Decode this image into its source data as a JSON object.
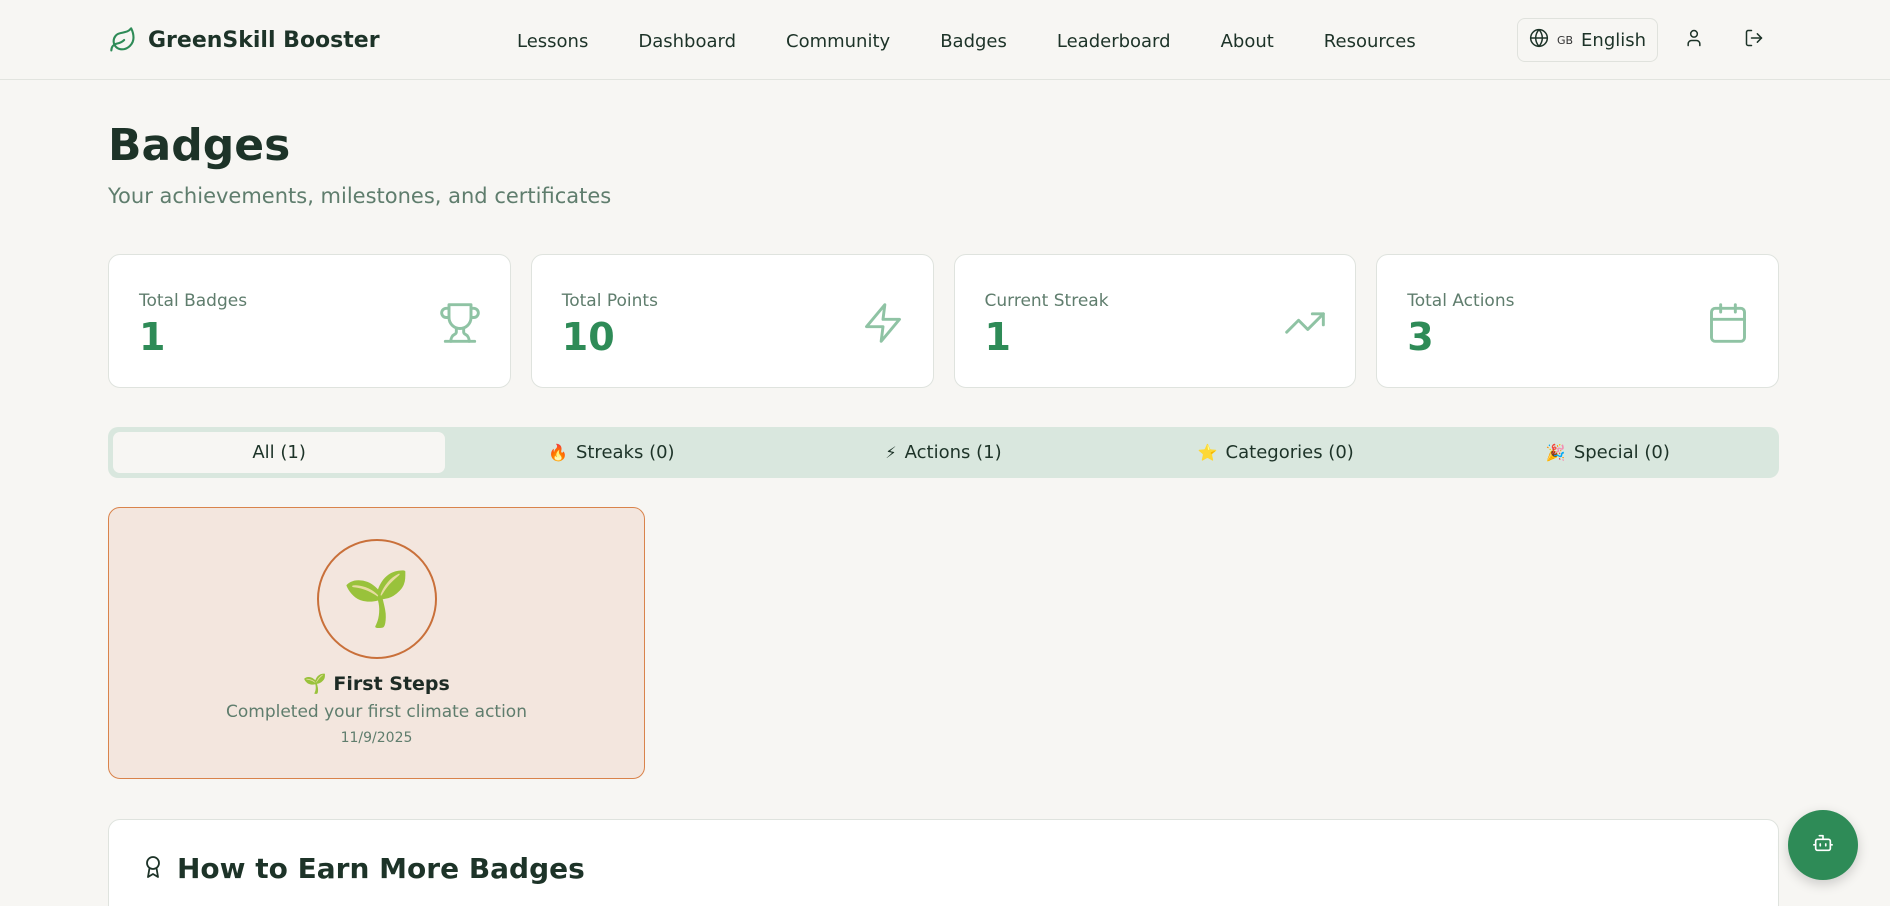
{
  "header": {
    "brand": "GreenSkill Booster",
    "nav": [
      "Lessons",
      "Dashboard",
      "Community",
      "Badges",
      "Leaderboard",
      "About",
      "Resources"
    ],
    "language_flag": "GB",
    "language": "English"
  },
  "page": {
    "title": "Badges",
    "subtitle": "Your achievements, milestones, and certificates"
  },
  "stats": [
    {
      "label": "Total Badges",
      "value": "1",
      "icon": "trophy-icon"
    },
    {
      "label": "Total Points",
      "value": "10",
      "icon": "lightning-icon"
    },
    {
      "label": "Current Streak",
      "value": "1",
      "icon": "trending-up-icon"
    },
    {
      "label": "Total Actions",
      "value": "3",
      "icon": "calendar-icon"
    }
  ],
  "tabs": [
    {
      "emoji": "",
      "label": "All (1)",
      "active": true
    },
    {
      "emoji": "🔥",
      "label": "Streaks (0)"
    },
    {
      "emoji": "⚡",
      "label": "Actions (1)"
    },
    {
      "emoji": "⭐",
      "label": "Categories (0)"
    },
    {
      "emoji": "🎉",
      "label": "Special (0)"
    }
  ],
  "badges": [
    {
      "emoji": "🌱",
      "title": "🌱 First Steps",
      "description": "Completed your first climate action",
      "date": "11/9/2025"
    }
  ],
  "earn_section": {
    "title": "How to Earn More Badges"
  },
  "colors": {
    "accent": "#2e8b57",
    "background": "#f7f6f3",
    "badge_border": "#d9834b",
    "badge_bg": "#f3e6de",
    "tabs_bg": "#d9e7de"
  }
}
